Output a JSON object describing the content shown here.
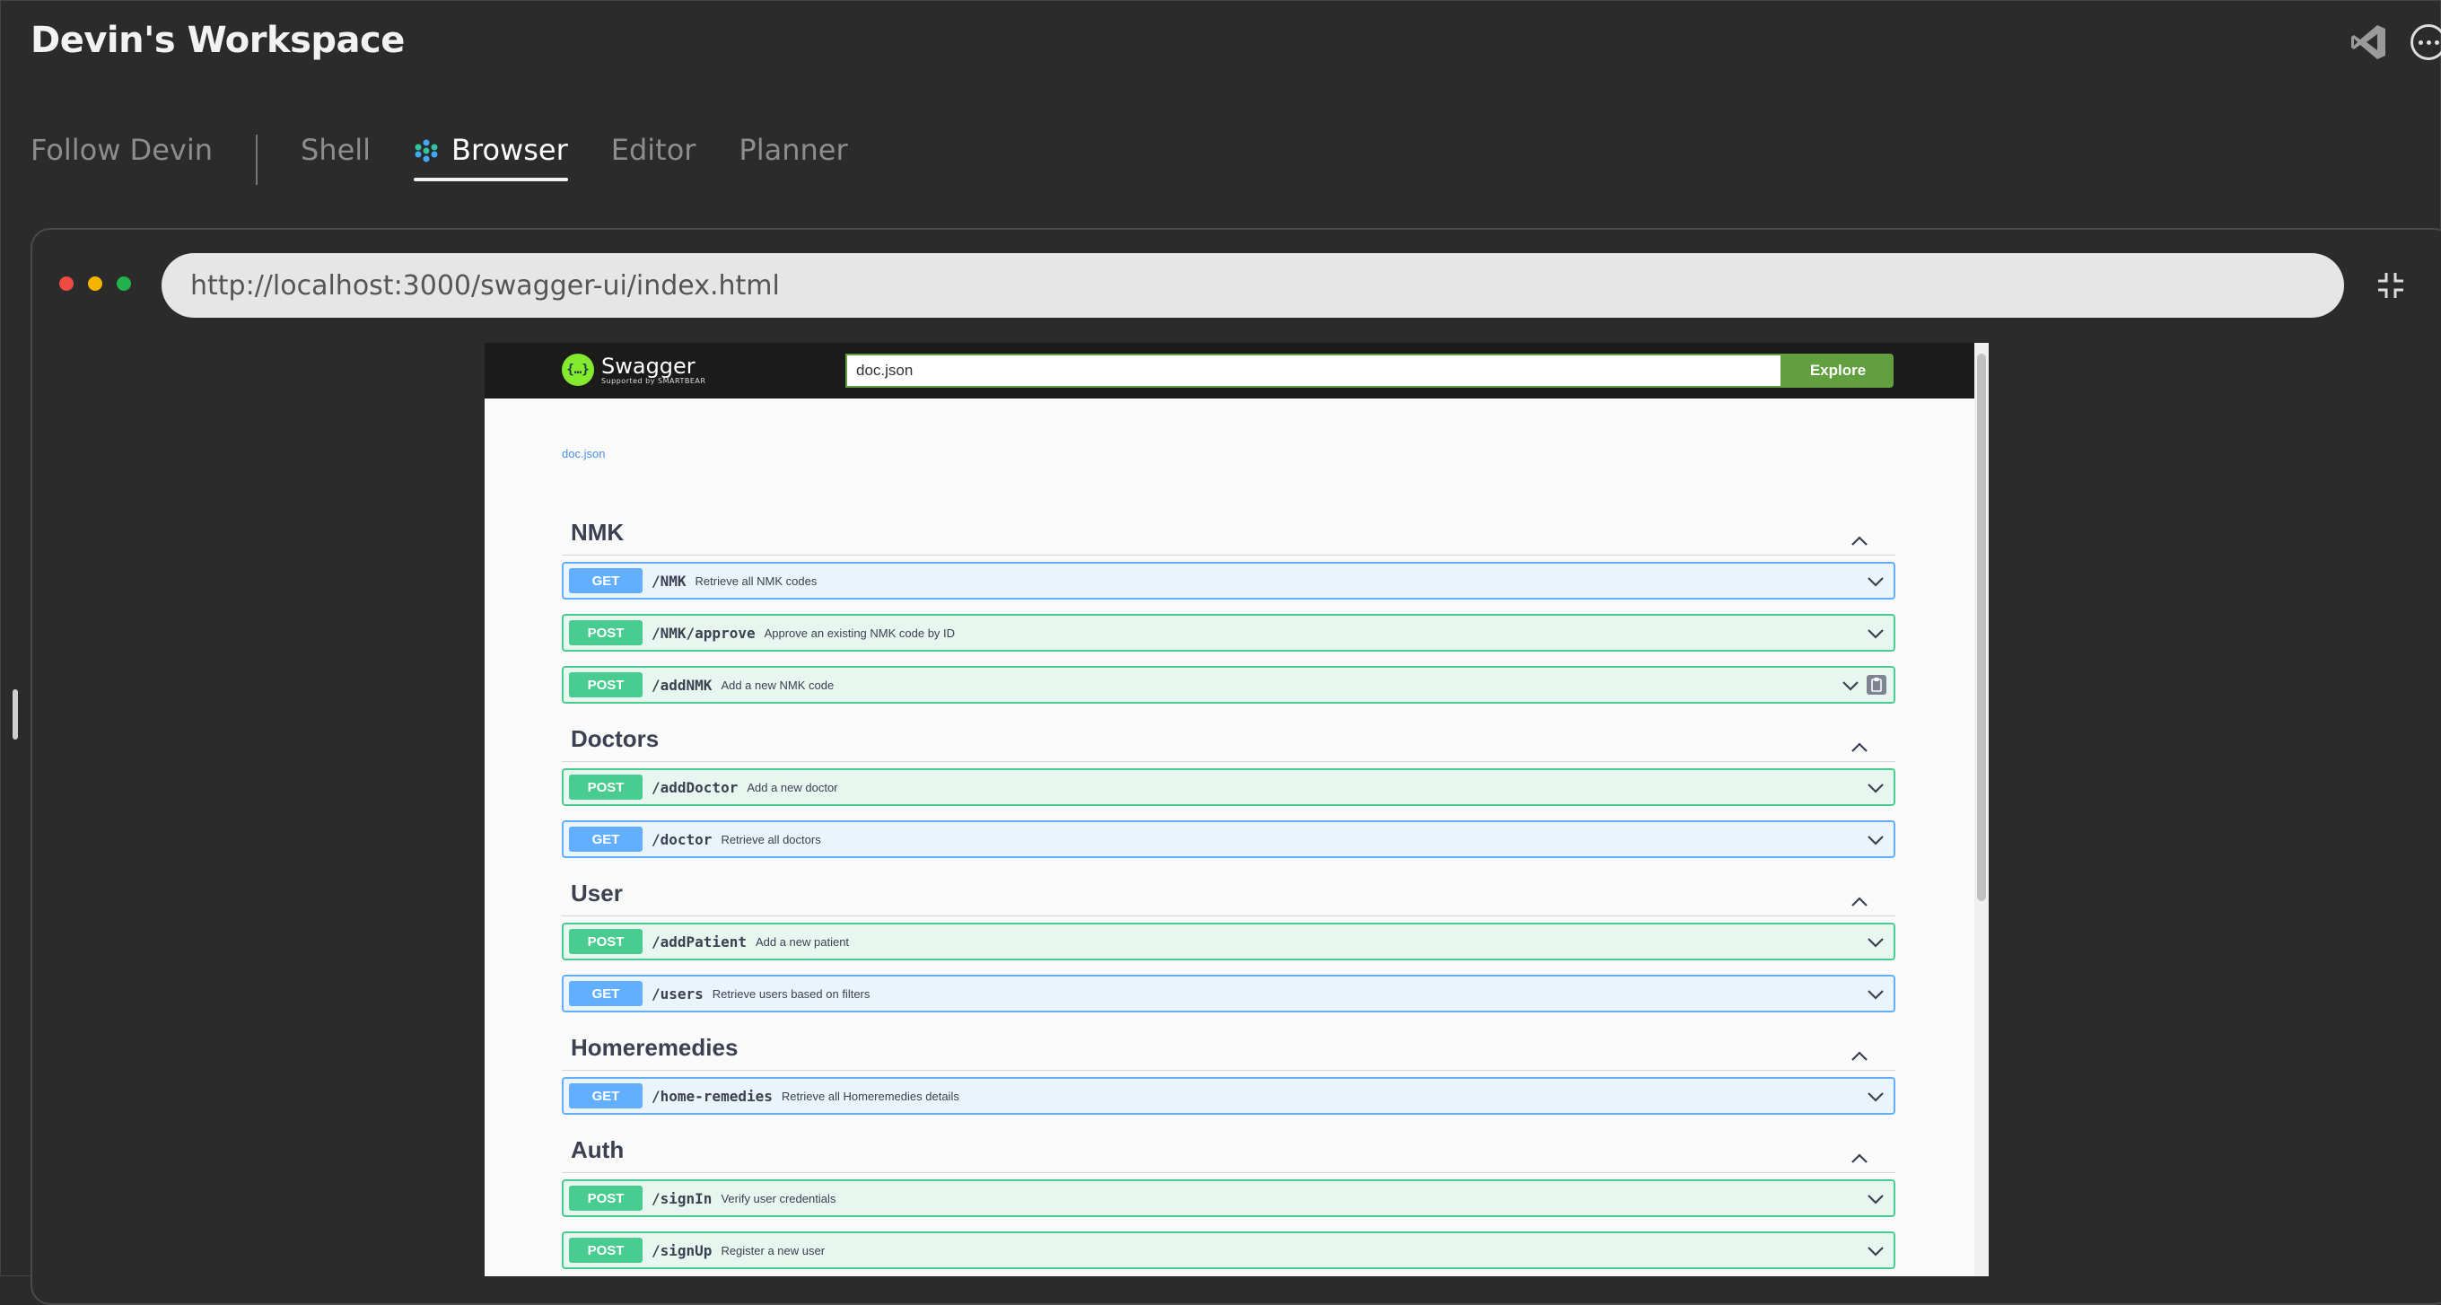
{
  "workspace": {
    "title": "Devin's Workspace"
  },
  "tabs": [
    {
      "label": "Follow Devin"
    },
    {
      "label": "Shell"
    },
    {
      "label": "Browser",
      "active": true
    },
    {
      "label": "Editor"
    },
    {
      "label": "Planner"
    }
  ],
  "browser": {
    "url": "http://localhost:3000/swagger-ui/index.html",
    "traffic_lights": [
      "#ed4b42",
      "#f4b400",
      "#22b14c"
    ]
  },
  "swagger": {
    "brand": "Swagger",
    "brand_sub": "Supported by SMARTBEAR",
    "logo_glyph": "{…}",
    "search_value": "doc.json",
    "explore_label": "Explore",
    "doc_link": "doc.json",
    "sections": [
      {
        "name": "NMK",
        "operations": [
          {
            "method": "GET",
            "path": "/NMK",
            "desc": "Retrieve all NMK codes"
          },
          {
            "method": "POST",
            "path": "/NMK/approve",
            "desc": "Approve an existing NMK code by ID"
          },
          {
            "method": "POST",
            "path": "/addNMK",
            "desc": "Add a new NMK code",
            "copy_icon": true
          }
        ]
      },
      {
        "name": "Doctors",
        "operations": [
          {
            "method": "POST",
            "path": "/addDoctor",
            "desc": "Add a new doctor"
          },
          {
            "method": "GET",
            "path": "/doctor",
            "desc": "Retrieve all doctors"
          }
        ]
      },
      {
        "name": "User",
        "operations": [
          {
            "method": "POST",
            "path": "/addPatient",
            "desc": "Add a new patient"
          },
          {
            "method": "GET",
            "path": "/users",
            "desc": "Retrieve users based on filters"
          }
        ]
      },
      {
        "name": "Homeremedies",
        "operations": [
          {
            "method": "GET",
            "path": "/home-remedies",
            "desc": "Retrieve all Homeremedies details"
          }
        ]
      },
      {
        "name": "Auth",
        "operations": [
          {
            "method": "POST",
            "path": "/signIn",
            "desc": "Verify user credentials"
          },
          {
            "method": "POST",
            "path": "/signUp",
            "desc": "Register a new user"
          }
        ]
      }
    ]
  },
  "colors": {
    "get": "#61affe",
    "post": "#49cc90",
    "explore": "#62a03f"
  }
}
